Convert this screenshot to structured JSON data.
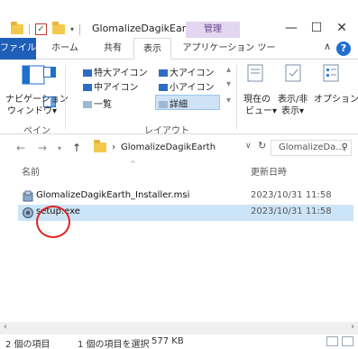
{
  "window": {
    "title": "GlomalizeDagikEarth",
    "context_tab": "管理",
    "controls": {
      "minimize": "—",
      "maximize": "☐",
      "close": "✕"
    }
  },
  "tabs": {
    "file": "ファイル",
    "home": "ホーム",
    "share": "共有",
    "view": "表示",
    "app_tools": "アプリケーション ツール"
  },
  "ribbon": {
    "nav_pane_line1": "ナビゲーション",
    "nav_pane_line2": "ウィンドウ▾",
    "pane_group": "ペイン",
    "extra_large": "特大アイコン",
    "large": "大アイコン",
    "medium": "中アイコン",
    "small": "小アイコン",
    "list": "一覧",
    "details": "詳細",
    "layout_group": "レイアウト",
    "current_view_line1": "現在の",
    "current_view_line2": "ビュー▾",
    "show_hide_line1": "表示/非",
    "show_hide_line2": "表示▾",
    "options": "オプション"
  },
  "address": {
    "path": "GlomalizeDagikEarth",
    "search_placeholder": "GlomalizeDa..."
  },
  "columns": {
    "name": "名前",
    "date": "更新日時"
  },
  "files": [
    {
      "name": "GlomalizeDagikEarth_Installer.msi",
      "date": "2023/10/31 11:58",
      "icon": "msi-installer-icon"
    },
    {
      "name": "setup.exe",
      "date": "2023/10/31 11:58",
      "icon": "setup-exe-icon"
    }
  ],
  "status": {
    "count": "2 個の項目",
    "selected": "1 個の項目を選択",
    "size": "577 KB"
  },
  "colors": {
    "accent": "#1f5fb8",
    "selection": "#cce4f7",
    "highlight_ring": "#e02020"
  }
}
